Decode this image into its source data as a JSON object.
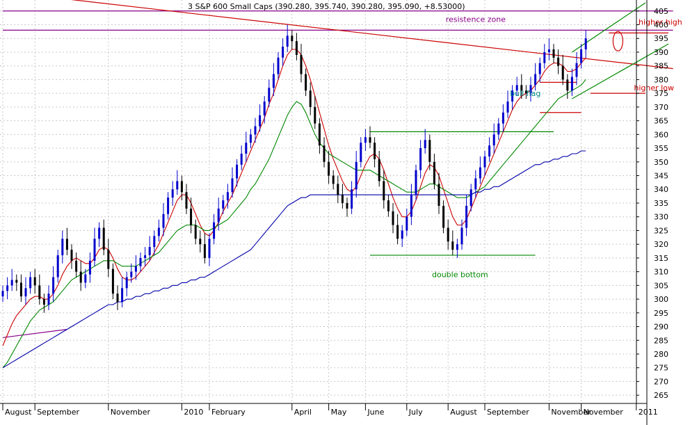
{
  "chart_data": {
    "type": "candlestick",
    "title": "3 S&P 600 Small Caps (390.280, 395.740, 390.280, 395.090, +8.53000)",
    "y_axis": {
      "position": "right",
      "ylim": [
        262,
        409
      ],
      "ticks": [
        265,
        270,
        275,
        280,
        285,
        290,
        295,
        300,
        305,
        310,
        315,
        320,
        325,
        330,
        335,
        340,
        345,
        350,
        355,
        360,
        365,
        370,
        375,
        380,
        385,
        390,
        395,
        400,
        405
      ]
    },
    "x_axis": {
      "labels": [
        "August",
        "September",
        "November",
        "2010",
        "February",
        "April",
        "May",
        "June",
        "July",
        "August",
        "September",
        "November",
        "November",
        "2011"
      ],
      "label_weeks": [
        0,
        7,
        23,
        39,
        45,
        63,
        71,
        79,
        88,
        97,
        105,
        119,
        126,
        138
      ]
    },
    "grid": true,
    "series": [
      {
        "kind": "price",
        "close": [
          303,
          305,
          307,
          306,
          301,
          304,
          308,
          305,
          300,
          298,
          302,
          308,
          316,
          322,
          318,
          314,
          310,
          306,
          309,
          314,
          322,
          326,
          318,
          311,
          302,
          299,
          304,
          308,
          310,
          312,
          315,
          316,
          319,
          323,
          326,
          331,
          337,
          340,
          343,
          339,
          333,
          327,
          322,
          320,
          315,
          322,
          328,
          333,
          336,
          339,
          344,
          349,
          353,
          357,
          360,
          363,
          367,
          372,
          377,
          382,
          388,
          392,
          396,
          394,
          389,
          382,
          376,
          370,
          364,
          356,
          350,
          345,
          342,
          338,
          335,
          333,
          340,
          350,
          357,
          359,
          357,
          351,
          343,
          336,
          332,
          327,
          322,
          325,
          330,
          338,
          347,
          355,
          358,
          350,
          342,
          334,
          326,
          321,
          318,
          320,
          326,
          334,
          340,
          344,
          348,
          352,
          356,
          360,
          364,
          368,
          372,
          376,
          378,
          376,
          375,
          378,
          382,
          386,
          390,
          391,
          388,
          385,
          380,
          376,
          381,
          386,
          391,
          395
        ]
      },
      {
        "kind": "ma_short",
        "color": "#cc0000",
        "values": [
          283,
          287,
          291,
          294,
          296,
          298,
          300,
          301,
          301,
          300,
          300,
          302,
          305,
          309,
          312,
          314,
          315,
          314,
          313,
          313,
          315,
          318,
          319,
          318,
          315,
          311,
          308,
          307,
          307,
          308,
          310,
          312,
          314,
          317,
          320,
          324,
          328,
          332,
          336,
          338,
          338,
          335,
          331,
          327,
          324,
          323,
          325,
          328,
          332,
          335,
          338,
          342,
          346,
          350,
          354,
          358,
          362,
          366,
          371,
          375,
          380,
          385,
          389,
          391,
          391,
          389,
          385,
          380,
          374,
          368,
          362,
          356,
          351,
          347,
          343,
          340,
          339,
          341,
          345,
          349,
          352,
          353,
          351,
          347,
          342,
          337,
          333,
          330,
          330,
          332,
          336,
          341,
          346,
          349,
          348,
          345,
          340,
          335,
          330,
          327,
          327,
          329,
          333,
          337,
          341,
          345,
          349,
          353,
          357,
          361,
          365,
          369,
          372,
          374,
          375,
          376,
          378,
          380,
          383,
          385,
          386,
          386,
          385,
          383,
          383,
          384,
          386,
          388
        ]
      },
      {
        "kind": "ma_medium",
        "color": "#008800",
        "values": [
          275,
          277,
          280,
          283,
          286,
          289,
          292,
          294,
          296,
          297,
          298,
          299,
          301,
          303,
          305,
          307,
          308,
          309,
          310,
          311,
          312,
          313,
          314,
          314,
          314,
          313,
          312,
          312,
          312,
          312,
          313,
          314,
          315,
          316,
          317,
          319,
          321,
          323,
          325,
          326,
          327,
          327,
          327,
          326,
          325,
          325,
          326,
          327,
          328,
          329,
          331,
          333,
          335,
          337,
          340,
          342,
          345,
          348,
          351,
          355,
          359,
          363,
          367,
          370,
          372,
          371,
          368,
          364,
          360,
          357,
          355,
          353,
          352,
          351,
          350,
          349,
          348,
          347,
          347,
          347,
          347,
          346,
          345,
          344,
          343,
          342,
          341,
          340,
          339,
          339,
          339,
          340,
          341,
          342,
          342,
          341,
          340,
          339,
          338,
          337,
          337,
          337,
          338,
          339,
          340,
          341,
          343,
          345,
          347,
          349,
          351,
          353,
          355,
          357,
          359,
          361,
          363,
          365,
          367,
          369,
          371,
          373,
          374,
          375,
          376,
          377,
          378,
          380
        ]
      },
      {
        "kind": "ma_long",
        "color": "#0000aa",
        "values": [
          275,
          276,
          277,
          278,
          279,
          280,
          281,
          282,
          283,
          284,
          285,
          286,
          287,
          288,
          289,
          290,
          291,
          292,
          293,
          294,
          295,
          296,
          297,
          298,
          298,
          299,
          299,
          300,
          300,
          301,
          301,
          302,
          302,
          303,
          303,
          304,
          304,
          305,
          305,
          306,
          306,
          307,
          307,
          308,
          308,
          309,
          310,
          311,
          312,
          313,
          314,
          315,
          316,
          317,
          318,
          320,
          322,
          324,
          326,
          328,
          330,
          332,
          334,
          335,
          336,
          337,
          337,
          338,
          338,
          338,
          338,
          338,
          338,
          338,
          338,
          338,
          338,
          338,
          338,
          338,
          338,
          338,
          338,
          338,
          338,
          338,
          338,
          338,
          338,
          338,
          338,
          338,
          338,
          338,
          338,
          338,
          338,
          338,
          338,
          338,
          338,
          338,
          338,
          339,
          339,
          340,
          340,
          341,
          341,
          342,
          343,
          344,
          345,
          346,
          347,
          348,
          349,
          349,
          350,
          350,
          351,
          351,
          352,
          352,
          353,
          353,
          354,
          354
        ]
      }
    ],
    "lines": [
      {
        "name": "resistance-line",
        "color": "#880088",
        "x1": 0,
        "y1": 398,
        "x2": 146,
        "y2": 398
      },
      {
        "name": "top-horizontal",
        "color": "#880088",
        "x1": 0,
        "y1": 405,
        "x2": 146,
        "y2": 405
      },
      {
        "name": "downtrend-line",
        "color": "#cc0000",
        "x1": 0,
        "y1": 412,
        "x2": 146,
        "y2": 384
      },
      {
        "name": "double-top-line",
        "color": "#008800",
        "x1": 80,
        "y1": 361,
        "x2": 120,
        "y2": 361
      },
      {
        "name": "double-bottom-line",
        "color": "#008800",
        "x1": 80,
        "y1": 316,
        "x2": 116,
        "y2": 316
      },
      {
        "name": "flag-top",
        "color": "#cc0000",
        "x1": 117,
        "y1": 379,
        "x2": 125,
        "y2": 379
      },
      {
        "name": "flag-bottom",
        "color": "#cc0000",
        "x1": 117,
        "y1": 368,
        "x2": 126,
        "y2": 368
      },
      {
        "name": "channel-upper",
        "color": "#008800",
        "x1": 124,
        "y1": 390,
        "x2": 140,
        "y2": 408
      },
      {
        "name": "channel-lower",
        "color": "#008800",
        "x1": 124,
        "y1": 373,
        "x2": 145,
        "y2": 393
      },
      {
        "name": "higher-high-line",
        "color": "#cc0000",
        "x1": 132,
        "y1": 397,
        "x2": 145,
        "y2": 397
      },
      {
        "name": "higher-low-line",
        "color": "#cc0000",
        "x1": 128,
        "y1": 375,
        "x2": 140,
        "y2": 375
      },
      {
        "name": "left-purple-line",
        "color": "#880088",
        "x1": 0,
        "y1": 286,
        "x2": 14,
        "y2": 289
      }
    ],
    "annotations": [
      {
        "text": "resistence zone",
        "color": "#880088",
        "week": 98,
        "value": 401
      },
      {
        "text": "bull flag",
        "color": "#008888",
        "week": 112,
        "value": 374
      },
      {
        "text": "double bottom",
        "color": "#008800",
        "week": 95,
        "value": 308
      },
      {
        "text": "higher high",
        "color": "#cc0000",
        "week": 140,
        "value": 400
      },
      {
        "text": "higher low",
        "color": "#cc0000",
        "week": 139,
        "value": 376
      }
    ]
  }
}
